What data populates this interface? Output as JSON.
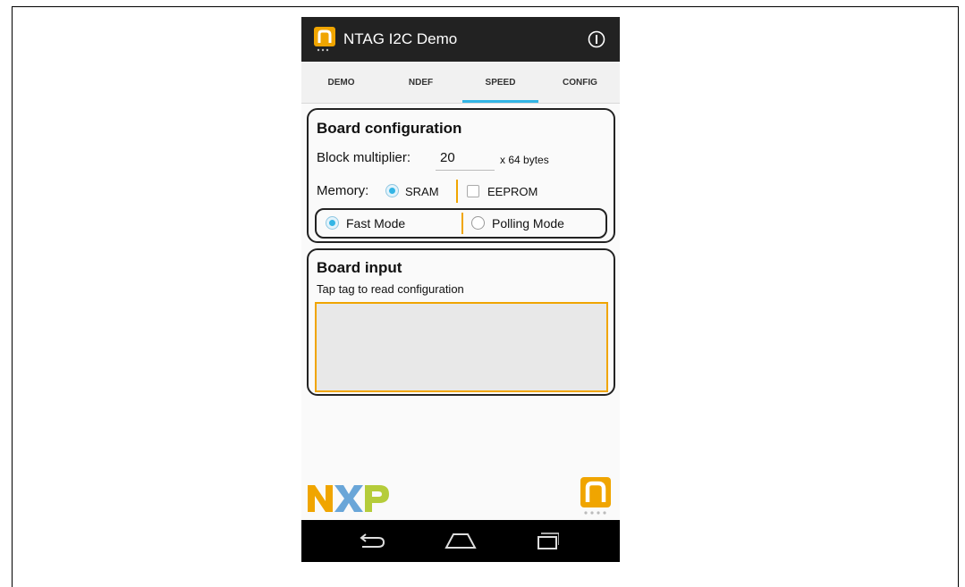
{
  "app": {
    "title": "NTAG I2C Demo",
    "icons": {
      "logo": "ntag-logo-icon",
      "info": "info-icon"
    }
  },
  "tabs": [
    {
      "label": "DEMO",
      "selected": false
    },
    {
      "label": "NDEF",
      "selected": false
    },
    {
      "label": "SPEED",
      "selected": true
    },
    {
      "label": "CONFIG",
      "selected": false
    }
  ],
  "board_config": {
    "title": "Board configuration",
    "block_multiplier_label": "Block multiplier:",
    "block_multiplier_value": "20",
    "block_unit": "x 64 bytes",
    "memory_label": "Memory:",
    "memory_options": [
      {
        "label": "SRAM",
        "checked": true
      },
      {
        "label": "EEPROM",
        "checked": false
      }
    ],
    "mode_options": [
      {
        "label": "Fast Mode",
        "checked": true
      },
      {
        "label": "Polling Mode",
        "checked": false
      }
    ]
  },
  "board_input": {
    "title": "Board input",
    "subtitle": "Tap tag to read configuration",
    "content": ""
  },
  "footer": {
    "logos": [
      "nxp-logo",
      "ntag-logo-icon"
    ]
  },
  "navbar": {
    "icons": [
      "back-icon",
      "home-icon",
      "recent-apps-icon"
    ]
  },
  "colors": {
    "accent": "#33b5e5",
    "orange": "#f0a500",
    "actionbar": "#222222",
    "navbar": "#000000"
  }
}
